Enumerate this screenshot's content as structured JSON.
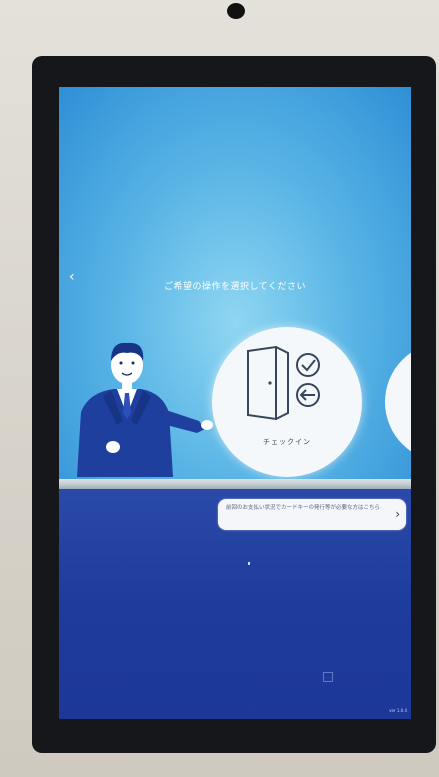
{
  "screen": {
    "prompt": "ご希望の操作を選択してください",
    "back_icon": "chevron-left-icon"
  },
  "options": [
    {
      "label": "チェックイン",
      "icon": "door-check-arrow-icon"
    },
    {
      "label": "",
      "icon": "next-option-icon"
    }
  ],
  "notice_button": {
    "text": "前回のお支払い状況でカードキーの発行等が必要な方はこちら",
    "icon": "chevron-right-icon"
  },
  "footer": {
    "version": "ver 1.0.4"
  },
  "colors": {
    "upper_bg": "#5bb6e6",
    "lower_bg": "#1f3c9d",
    "circle": "#f4f8fb",
    "bezel": "#15171a"
  }
}
